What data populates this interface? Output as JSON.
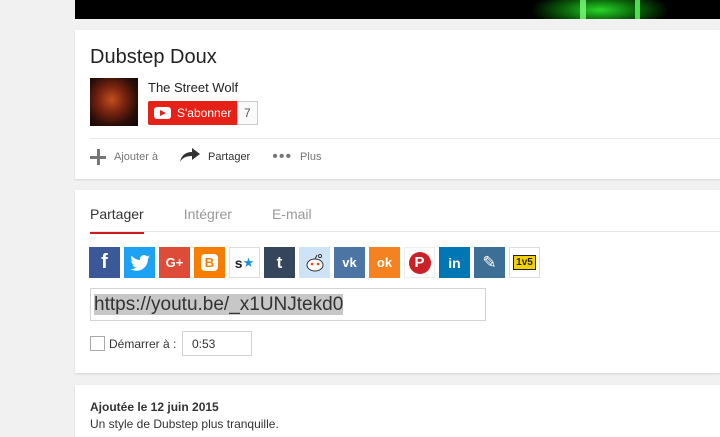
{
  "video": {
    "title": "Dubstep Doux"
  },
  "channel": {
    "name": "The Street Wolf",
    "subscribe_label": "S'abonner",
    "subscriber_count": "7"
  },
  "actions": {
    "add_to": "Ajouter à",
    "share": "Partager",
    "more": "Plus"
  },
  "share": {
    "tabs": [
      "Partager",
      "Intégrer",
      "E-mail"
    ],
    "social_icons": [
      {
        "name": "facebook",
        "glyph": "f",
        "color": "#3b5998"
      },
      {
        "name": "twitter",
        "glyph": "t",
        "color": "#1da1f2"
      },
      {
        "name": "google-plus",
        "glyph": "G+",
        "color": "#dd4b39"
      },
      {
        "name": "blogger",
        "glyph": "B",
        "color": "#f57d00"
      },
      {
        "name": "stumbleupon",
        "glyph": "s★",
        "color": "#ffffff"
      },
      {
        "name": "tumblr",
        "glyph": "t",
        "color": "#35465c"
      },
      {
        "name": "reddit",
        "glyph": "●",
        "color": "#cee3f8"
      },
      {
        "name": "vk",
        "glyph": "vk",
        "color": "#4c75a3"
      },
      {
        "name": "odnoklassniki",
        "glyph": "ok",
        "color": "#f58220"
      },
      {
        "name": "pinterest",
        "glyph": "P",
        "color": "#cb2027"
      },
      {
        "name": "linkedin",
        "glyph": "in",
        "color": "#0077b5"
      },
      {
        "name": "livejournal",
        "glyph": "✎",
        "color": "#3d6e95"
      },
      {
        "name": "1v5",
        "glyph": "1v5",
        "color": "#ffffff"
      }
    ],
    "url": "https://youtu.be/_x1UNJtekd0",
    "start_label": "Démarrer à :",
    "start_time": "0:53",
    "start_checked": false
  },
  "description": {
    "published": "Ajoutée le 12 juin 2015",
    "text": "Un style de Dubstep plus tranquille."
  }
}
